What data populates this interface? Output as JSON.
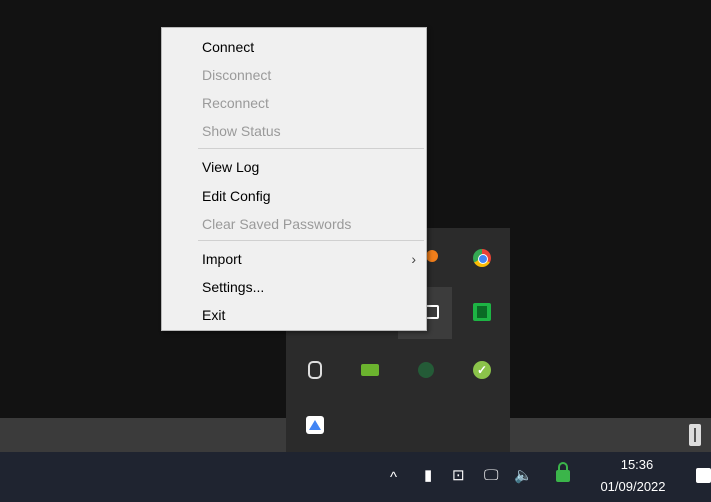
{
  "context_menu": {
    "items": [
      {
        "label": "Connect",
        "enabled": true
      },
      {
        "label": "Disconnect",
        "enabled": false
      },
      {
        "label": "Reconnect",
        "enabled": false
      },
      {
        "label": "Show Status",
        "enabled": false
      },
      {
        "label": "View Log",
        "enabled": true
      },
      {
        "label": "Edit Config",
        "enabled": true
      },
      {
        "label": "Clear Saved Passwords",
        "enabled": false
      },
      {
        "label": "Import",
        "enabled": true,
        "submenu": true
      },
      {
        "label": "Settings...",
        "enabled": true
      },
      {
        "label": "Exit",
        "enabled": true
      }
    ]
  },
  "tray_flyout": {
    "icons": [
      "orange-app-icon",
      "chrome-icon",
      "white-app-icon",
      "green-app-icon",
      "teams-icon",
      "nvidia-icon",
      "dark-green-icon",
      "green-check-icon",
      "google-drive-icon"
    ]
  },
  "taskbar": {
    "clock": {
      "time": "15:36",
      "date": "01/09/2022"
    },
    "tray_icons": [
      "chevron-up-icon",
      "usb-icon",
      "app-icon",
      "network-icon",
      "volume-icon",
      "vpn-lock-icon",
      "notification-icon"
    ],
    "glyphs": {
      "chevron": "^",
      "usb": "▮",
      "app": "⊡",
      "network": "🖵",
      "volume": "🔈",
      "submenu": "›"
    }
  }
}
